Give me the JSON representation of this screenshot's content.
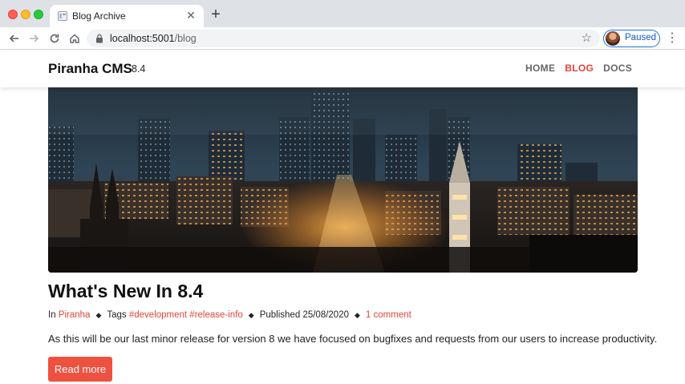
{
  "browser": {
    "tab_title": "Blog Archive",
    "url_host": "localhost:5001",
    "url_path": "/blog",
    "profile_status": "Paused"
  },
  "site": {
    "brand": "Piranha CMS",
    "version": "8.4",
    "nav": [
      {
        "label": "HOME",
        "active": false
      },
      {
        "label": "BLOG",
        "active": true
      },
      {
        "label": "DOCS",
        "active": false
      }
    ]
  },
  "post": {
    "title": "What's New In 8.4",
    "meta": {
      "in_prefix": "In",
      "category": "Piranha",
      "tags_prefix": "Tags",
      "tags": "#development #release-info",
      "published_prefix": "Published",
      "published_date": "25/08/2020",
      "comments": "1 comment"
    },
    "excerpt": "As this will be our last minor release for version 8 we have focused on bugfixes and requests from our users to increase productivity.",
    "read_more": "Read more"
  },
  "colors": {
    "accent": "#e2453a",
    "button": "#ee5140"
  }
}
